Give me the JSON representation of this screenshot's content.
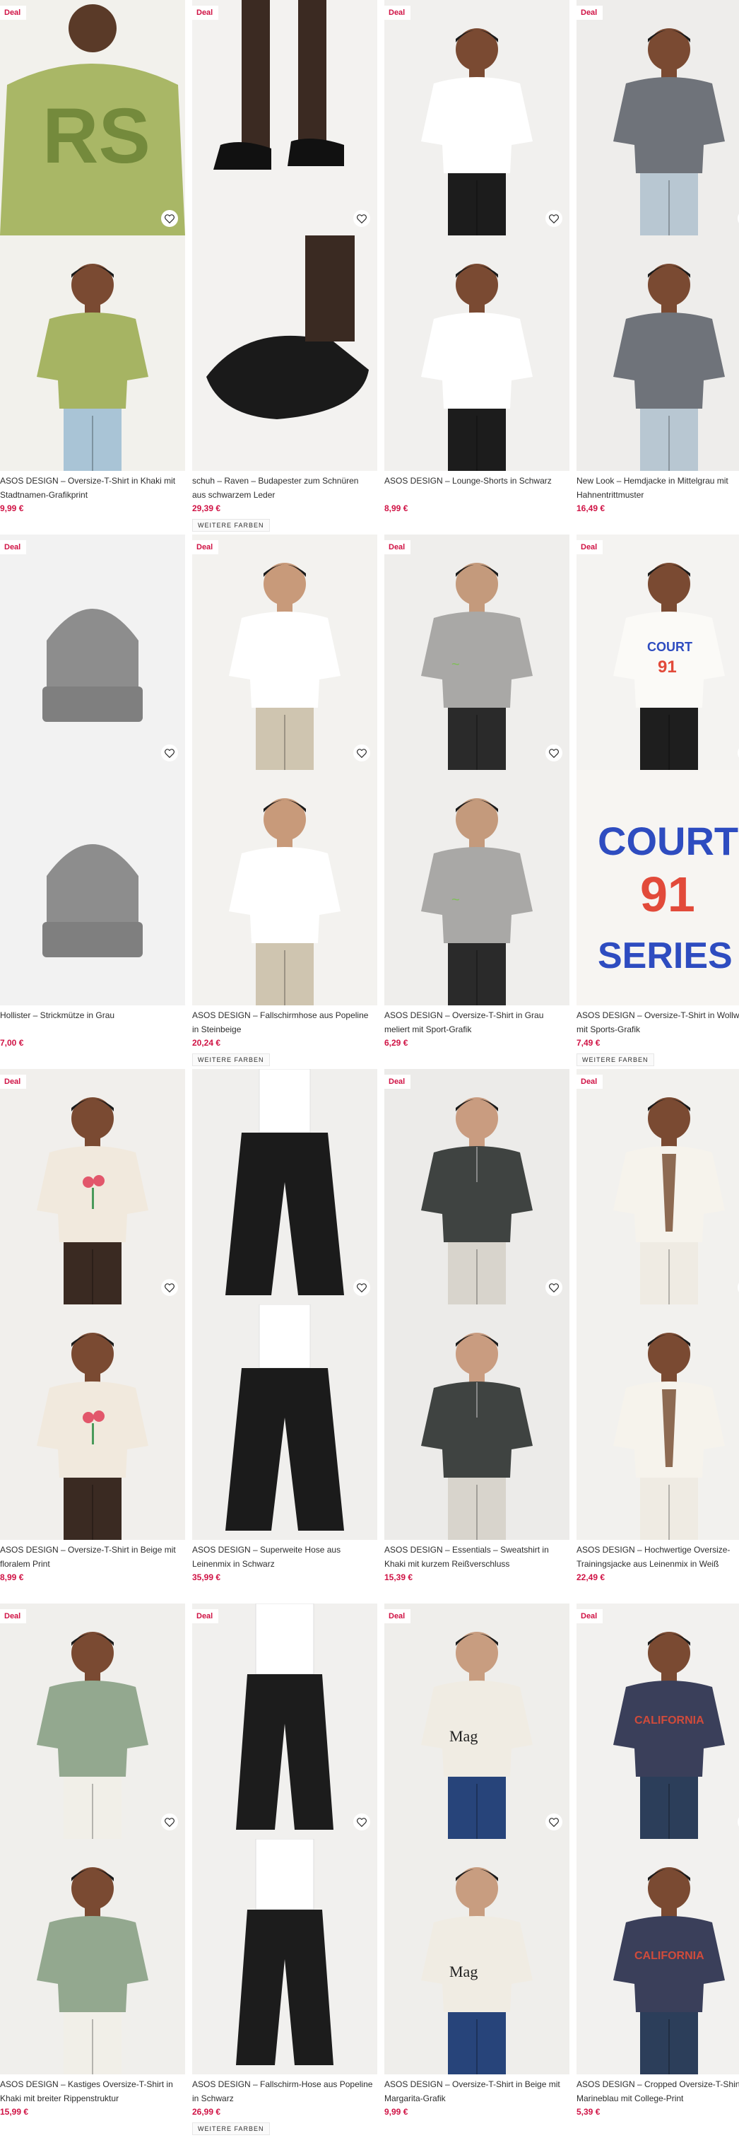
{
  "deal_label": "Deal",
  "more_colors_label": "WEITERE FARBEN",
  "colors": {
    "price": "#d01345",
    "text": "#2d2d2d",
    "deal": "#d01345"
  },
  "products": [
    {
      "title": "ASOS DESIGN – Oversize-T-Shirt in Khaki mit Stadtnamen-Grafikprint",
      "price": "9,99 €",
      "deal": true,
      "more_colors": false,
      "scene": "khaki-tee"
    },
    {
      "title": "schuh – Raven – Budapester zum Schnüren aus schwarzem Leder",
      "price": "29,39 €",
      "deal": true,
      "more_colors": true,
      "scene": "black-shoes"
    },
    {
      "title": "ASOS DESIGN – Lounge-Shorts in Schwarz",
      "price": "8,99 €",
      "deal": true,
      "more_colors": false,
      "scene": "black-shorts"
    },
    {
      "title": "New Look – Hemdjacke in Mittelgrau mit Hahnentrittmuster",
      "price": "16,49 €",
      "deal": true,
      "more_colors": false,
      "scene": "grey-jacket"
    },
    {
      "title": "Hollister – Strickmütze in Grau",
      "price": "7,00 €",
      "deal": true,
      "more_colors": false,
      "scene": "grey-beanie"
    },
    {
      "title": "ASOS DESIGN – Fallschirmhose aus Popeline in Steinbeige",
      "price": "20,24 €",
      "deal": true,
      "more_colors": true,
      "scene": "beige-pants"
    },
    {
      "title": "ASOS DESIGN – Oversize-T-Shirt in Grau meliert mit Sport-Grafik",
      "price": "6,29 €",
      "deal": true,
      "more_colors": false,
      "scene": "grey-tee"
    },
    {
      "title": "ASOS DESIGN – Oversize-T-Shirt in Wollweiß mit Sports-Grafik",
      "price": "7,49 €",
      "deal": true,
      "more_colors": true,
      "scene": "court-tee"
    },
    {
      "title": "ASOS DESIGN – Oversize-T-Shirt in Beige mit floralem Print",
      "price": "8,99 €",
      "deal": true,
      "more_colors": false,
      "scene": "floral-tee"
    },
    {
      "title": "ASOS DESIGN – Superweite Hose aus Leinenmix in Schwarz",
      "price": "35,99 €",
      "deal": false,
      "more_colors": false,
      "scene": "wide-black-pants"
    },
    {
      "title": "ASOS DESIGN – Essentials – Sweatshirt in Khaki mit kurzem Reißverschluss",
      "price": "15,39 €",
      "deal": true,
      "more_colors": false,
      "scene": "zip-sweat"
    },
    {
      "title": "ASOS DESIGN – Hochwertige Oversize-Trainingsjacke aus Leinenmix in Weiß",
      "price": "22,49 €",
      "deal": true,
      "more_colors": false,
      "scene": "white-jacket"
    },
    {
      "title": "ASOS DESIGN – Kastiges Oversize-T-Shirt in Khaki mit breiter Rippenstruktur",
      "price": "15,99 €",
      "deal": true,
      "more_colors": false,
      "scene": "sage-tee"
    },
    {
      "title": "ASOS DESIGN – Fallschirm-Hose aus Popeline in Schwarz",
      "price": "26,99 €",
      "deal": true,
      "more_colors": true,
      "scene": "black-cargo"
    },
    {
      "title": "ASOS DESIGN – Oversize-T-Shirt in Beige mit Margarita-Grafik",
      "price": "9,99 €",
      "deal": true,
      "more_colors": false,
      "scene": "margarita-tee"
    },
    {
      "title": "ASOS DESIGN – Cropped Oversize-T-Shirt in Marineblau mit College-Print",
      "price": "5,39 €",
      "deal": true,
      "more_colors": false,
      "scene": "navy-tee"
    }
  ]
}
